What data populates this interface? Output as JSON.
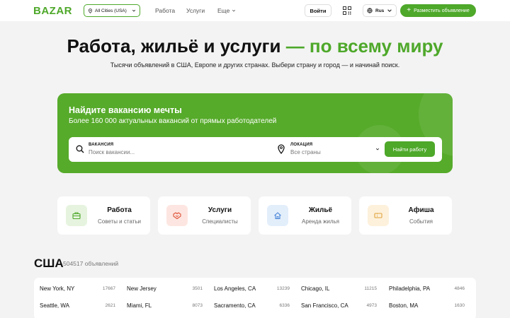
{
  "header": {
    "logo": "BAZAR",
    "city_select": "All Cities (USA)",
    "nav": [
      "Работа",
      "Услуги",
      "Еще"
    ],
    "login": "Войти",
    "language": "Rus",
    "post_button": "Разместить объявление"
  },
  "hero": {
    "title_main": "Работа, жильё и услуги",
    "title_accent": "— по всему миру",
    "subtitle": "Тысячи объявлений в США, Европе и других странах. Выбери страну и город — и начинай поиск."
  },
  "job_search": {
    "title": "Найдите вакансию мечты",
    "subtitle": "Более 160 000 актуальных вакансий от прямых работодателей",
    "vacancy_label": "ВАКАНСИЯ",
    "vacancy_placeholder": "Поиск вакансии...",
    "location_label": "ЛОКАЦИЯ",
    "location_value": "Все страны",
    "button": "Найти работу"
  },
  "categories": [
    {
      "title": "Работа",
      "subtitle": "Советы и статьи",
      "icon": "briefcase-icon",
      "bg": "#e6f4df",
      "color": "#4ea82a"
    },
    {
      "title": "Услуги",
      "subtitle": "Специалисты",
      "icon": "handshake-icon",
      "bg": "#fde6e1",
      "color": "#e0553b"
    },
    {
      "title": "Жильё",
      "subtitle": "Аренда жилья",
      "icon": "home-icon",
      "bg": "#e3eefb",
      "color": "#4a86d8"
    },
    {
      "title": "Афиша",
      "subtitle": "События",
      "icon": "ticket-icon",
      "bg": "#fdf1dc",
      "color": "#e0a23b"
    }
  ],
  "country": {
    "name": "США",
    "count": "504517 объявлений",
    "cities": [
      {
        "name": "New York, NY",
        "count": "17667"
      },
      {
        "name": "New Jersey",
        "count": "3501"
      },
      {
        "name": "Los Angeles, CA",
        "count": "13239"
      },
      {
        "name": "Chicago, IL",
        "count": "11215"
      },
      {
        "name": "Philadelphia, PA",
        "count": "4846"
      },
      {
        "name": "Seattle, WA",
        "count": "2621"
      },
      {
        "name": "Miami, FL",
        "count": "8073"
      },
      {
        "name": "Sacramento, CA",
        "count": "6336"
      },
      {
        "name": "San Francisco, CA",
        "count": "4973"
      },
      {
        "name": "Boston, MA",
        "count": "1630"
      }
    ]
  },
  "colors": {
    "brand": "#4ea82a",
    "card": "#56ab2a"
  }
}
